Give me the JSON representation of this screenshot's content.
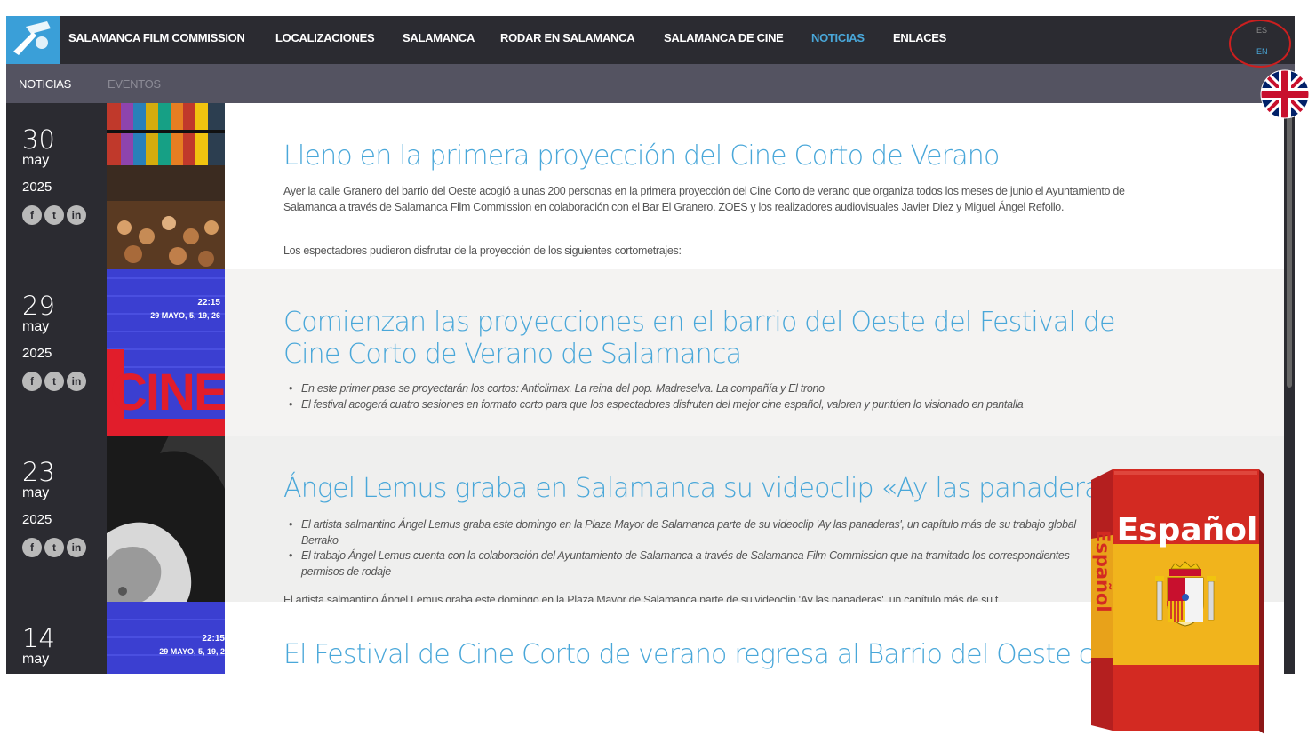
{
  "nav": {
    "items": [
      "SALAMANCA FILM COMMISSION",
      "LOCALIZACIONES",
      "SALAMANCA",
      "RODAR EN SALAMANCA",
      "SALAMANCA DE CINE",
      "NOTICIAS",
      "ENLACES"
    ],
    "active": "NOTICIAS",
    "lang": {
      "es": "ES",
      "en": "EN"
    }
  },
  "subnav": {
    "items": [
      "NOTICIAS",
      "EVENTOS"
    ],
    "active": "NOTICIAS"
  },
  "social_icons": [
    "facebook-icon",
    "twitter-icon",
    "linkedin-icon"
  ],
  "social_glyphs": [
    "f",
    "t",
    "in"
  ],
  "posts": [
    {
      "day": "30",
      "month": "may",
      "year": "2025",
      "title": "Lleno en la primera proyección del Cine Corto de Verano",
      "paragraph": "Ayer la calle Granero del barrio del Oeste acogió a unas 200 personas en la primera proyección del Cine Corto de verano que organiza todos los meses de junio el Ayuntamiento de Salamanca a través de Salamanca Film Commission en colaboración con el Bar El Granero. ZOES y los realizadores audiovisuales Javier Diez y Miguel Ángel Refollo.",
      "paragraph2": "Los espectadores pudieron disfrutar de la proyección de los siguientes cortometrajes:"
    },
    {
      "day": "29",
      "month": "may",
      "year": "2025",
      "title": "Comienzan las proyecciones en el barrio del Oeste del Festival de Cine Corto de Verano de Salamanca",
      "bullets": [
        "En este primer pase se proyectarán los cortos: Anticlimax. La reina del pop. Madreselva. La compañía y El trono",
        "El festival acogerá cuatro sesiones en formato corto para que los espectadores disfruten del mejor cine español, valoren y puntúen lo visionado en pantalla"
      ],
      "poster": {
        "time": "22:15",
        "dates": "29 MAYO, 5, 19, 26",
        "word": "CINE"
      }
    },
    {
      "day": "23",
      "month": "may",
      "year": "2025",
      "title": "Ángel Lemus graba en Salamanca su videoclip «Ay las panaderas»",
      "bullets": [
        "El artista salmantino Ángel Lemus graba este domingo en la Plaza Mayor de Salamanca parte de su videoclip 'Ay las panaderas', un capítulo más de su trabajo global Berrako",
        "El trabajo Ángel Lemus cuenta con la colaboración del Ayuntamiento de Salamanca a través de Salamanca Film Commission que ha tramitado los correspondientes permisos de rodaje"
      ],
      "paragraph": "El artista salmantino Ángel Lemus graba este domingo en la Plaza Mayor de Salamanca parte de su videoclip 'Ay las panaderas', un capítulo más de su t"
    },
    {
      "day": "14",
      "month": "may",
      "year": "",
      "title": "El Festival de Cine Corto de verano regresa al Barrio del Oeste con los",
      "poster": {
        "time": "22:15",
        "dates": "29 MAYO, 5, 19, 2"
      }
    }
  ],
  "book": {
    "title": "Español",
    "spine": "Español"
  },
  "colors": {
    "accent": "#49a7d9",
    "nav_bg": "#2b2b31",
    "subnav_bg": "#545361",
    "highlight": "#cc1f1f"
  }
}
